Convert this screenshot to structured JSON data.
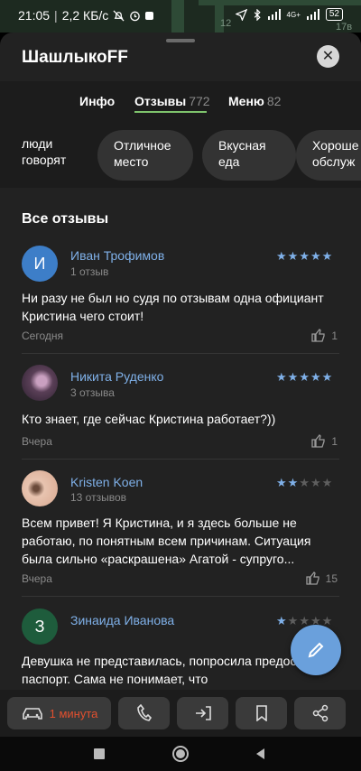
{
  "status": {
    "time": "21:05",
    "speed": "2,2 КБ/с",
    "battery": "52",
    "net": "4G+"
  },
  "map": {
    "labels": [
      "12",
      "17в"
    ]
  },
  "place": {
    "title": "ШашлыкоFF"
  },
  "tabs": [
    {
      "label": "Инфо",
      "count": ""
    },
    {
      "label": "Отзывы",
      "count": "772"
    },
    {
      "label": "Меню",
      "count": "82"
    }
  ],
  "chips": {
    "label": "люди\nговорят",
    "items": [
      "Отличное\nместо",
      "Вкусная\nеда",
      "Хороше\nобслуж"
    ]
  },
  "reviews_title": "Все отзывы",
  "reviews": [
    {
      "initial": "И",
      "avatar_color": "#3d7ec8",
      "name": "Иван Трофимов",
      "count": "1 отзыв",
      "rating": 5,
      "text": "Ни разу не был но судя по отзывам одна официант Кристина чего стоит!",
      "date": "Сегодня",
      "likes": "1"
    },
    {
      "initial": "",
      "avatar_color": "#5a3f57",
      "name": "Никита Руденко",
      "count": "3 отзыва",
      "rating": 5,
      "text": "Кто знает, где сейчас Кристина работает?))",
      "date": "Вчера",
      "likes": "1"
    },
    {
      "initial": "",
      "avatar_color": "#e8c4b0",
      "name": "Kristen Koen",
      "count": "13 отзывов",
      "rating": 2,
      "text": "Всем привет! Я Кристина, и я здесь больше не работаю, по понятным всем причинам. Ситуация была сильно «раскрашена» Агатой - супруго...",
      "date": "Вчера",
      "likes": "15"
    },
    {
      "initial": "З",
      "avatar_color": "#1e5c3c",
      "name": "Зинаида Иванова",
      "count": "",
      "rating": 1,
      "text": "Девушка не представилась, попросила предоставить паспорт. Сама не понимает, что",
      "date": "",
      "likes": ""
    }
  ],
  "actions": {
    "route_time": "1 минута"
  },
  "colors": {
    "accent": "#7fb0e8",
    "tab_underline": "#7ec36c",
    "route": "#e2502f"
  }
}
